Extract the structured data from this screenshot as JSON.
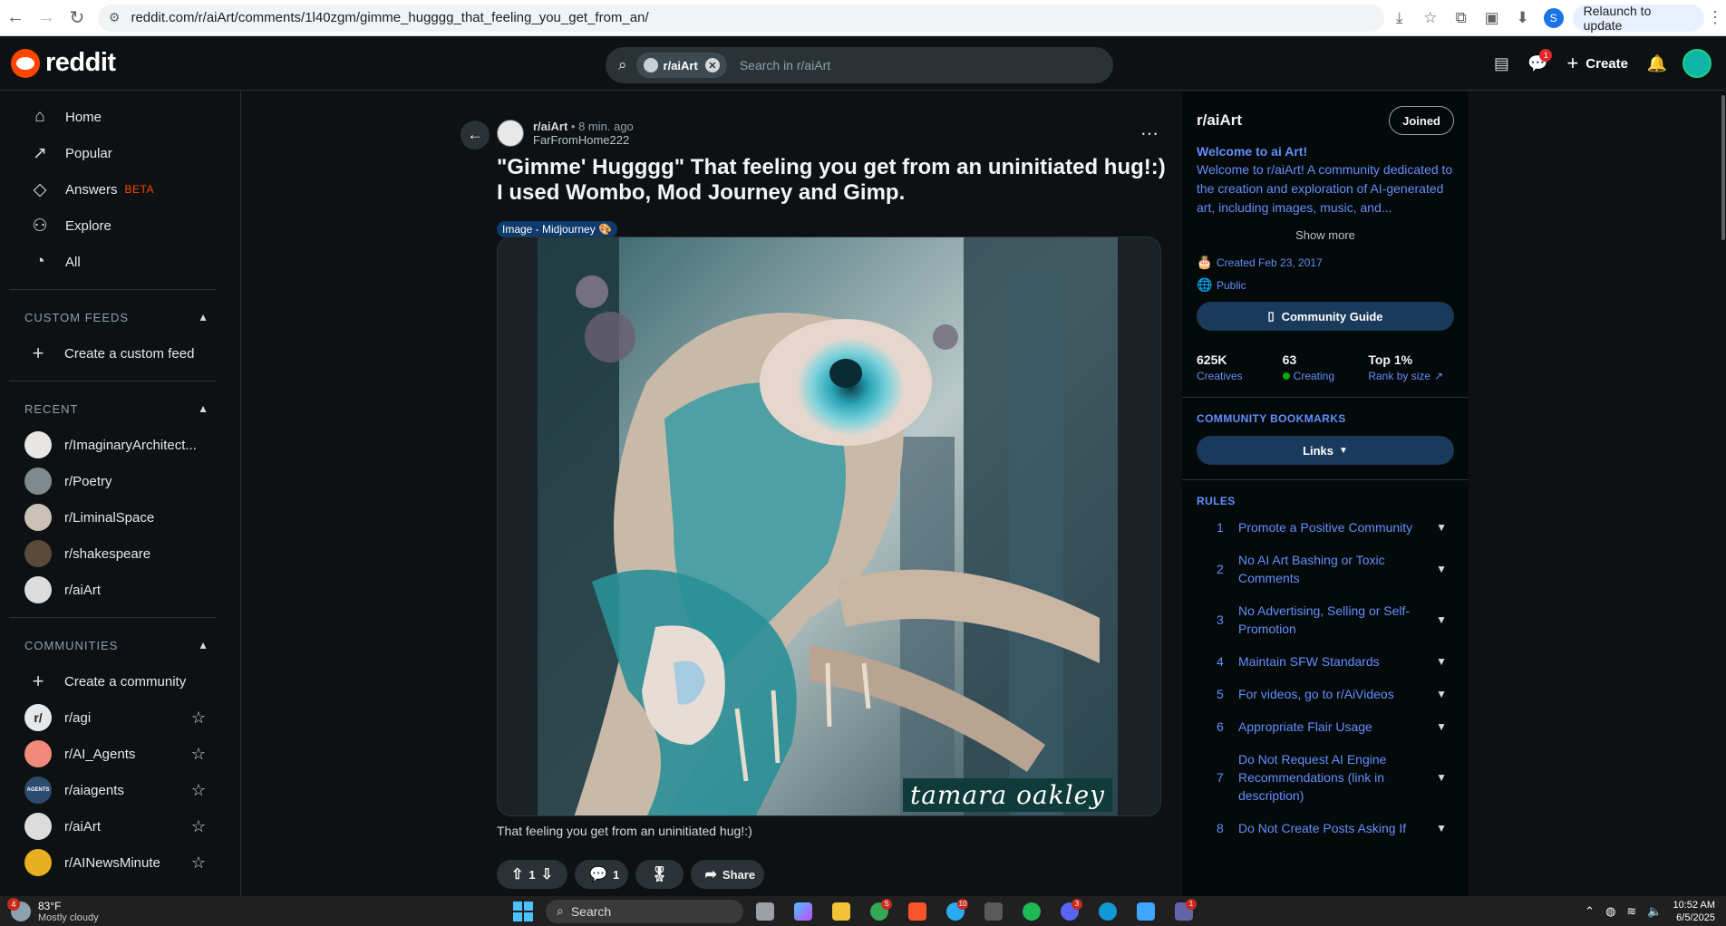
{
  "browser": {
    "url": "reddit.com/r/aiArt/comments/1l40zgm/gimme_hugggg_that_feeling_you_get_from_an/",
    "profile_initial": "S",
    "relaunch_label": "Relaunch to update"
  },
  "header": {
    "logo_text": "reddit",
    "search_chip": "r/aiArt",
    "search_placeholder": "Search in r/aiArt",
    "create_label": "Create",
    "chat_badge": "1"
  },
  "sidebar": {
    "nav": [
      {
        "label": "Home",
        "icon": "home-icon"
      },
      {
        "label": "Popular",
        "icon": "popular-icon"
      },
      {
        "label": "Answers",
        "icon": "answers-icon",
        "badge": "BETA"
      },
      {
        "label": "Explore",
        "icon": "explore-icon"
      },
      {
        "label": "All",
        "icon": "all-icon"
      }
    ],
    "custom_feeds_title": "CUSTOM FEEDS",
    "create_custom_feed": "Create a custom feed",
    "recent_title": "RECENT",
    "recent": [
      {
        "name": "r/ImaginaryArchitect...",
        "color": "#e8e6e2"
      },
      {
        "name": "r/Poetry",
        "color": "#7e8a8c"
      },
      {
        "name": "r/LiminalSpace",
        "color": "#c9c2b4"
      },
      {
        "name": "r/shakespeare",
        "color": "#5a4a3a"
      },
      {
        "name": "r/aiArt",
        "color": "#dcdcdc"
      }
    ],
    "communities_title": "COMMUNITIES",
    "create_community": "Create a community",
    "communities": [
      {
        "name": "r/agi",
        "color": "#e6e8e9",
        "mark": "r/"
      },
      {
        "name": "r/AI_Agents",
        "color": "#f08a7a",
        "mark": ""
      },
      {
        "name": "r/aiagents",
        "color": "#2b4b6f",
        "mark": "AGENTS"
      },
      {
        "name": "r/aiArt",
        "color": "#dcdcdc",
        "mark": ""
      },
      {
        "name": "r/AINewsMinute",
        "color": "#e8b020",
        "mark": ""
      }
    ]
  },
  "post": {
    "subreddit": "r/aiArt",
    "time": "• 8 min. ago",
    "author": "FarFromHome222",
    "title": "\"Gimme' Hugggg\" That feeling you get from an uninitiated hug!:) I used Wombo, Mod Journey and Gimp.",
    "flair": "Image - Midjourney 🎨",
    "watermark": "tamara oakley",
    "caption": "That feeling you get from an uninitiated hug!:)",
    "votes": "1",
    "comments": "1",
    "share_label": "Share"
  },
  "community": {
    "name": "r/aiArt",
    "joined_label": "Joined",
    "welcome_title": "Welcome to ai Art!",
    "welcome_desc": "Welcome to r/aiArt! A community dedicated to the creation and exploration of AI-generated art, including images, music, and...",
    "show_more": "Show more",
    "created": "Created Feb 23, 2017",
    "visibility": "Public",
    "guide_label": "Community Guide",
    "stats": [
      {
        "value": "625K",
        "label": "Creatives"
      },
      {
        "value": "63",
        "label": "Creating"
      },
      {
        "value": "Top 1%",
        "label": "Rank by size"
      }
    ],
    "bookmarks_title": "COMMUNITY BOOKMARKS",
    "links_label": "Links",
    "rules_title": "RULES",
    "rules": [
      {
        "n": "1",
        "text": "Promote a Positive Community"
      },
      {
        "n": "2",
        "text": "No AI Art Bashing or Toxic Comments"
      },
      {
        "n": "3",
        "text": "No Advertising, Selling or Self-Promotion"
      },
      {
        "n": "4",
        "text": "Maintain SFW Standards"
      },
      {
        "n": "5",
        "text": "For videos, go to r/AiVideos"
      },
      {
        "n": "6",
        "text": "Appropriate Flair Usage"
      },
      {
        "n": "7",
        "text": "Do Not Request AI Engine Recommendations (link in description)"
      },
      {
        "n": "8",
        "text": "Do Not Create Posts Asking If"
      }
    ]
  },
  "taskbar": {
    "temp": "83°F",
    "weather": "Mostly cloudy",
    "weather_badge": "4",
    "search_label": "Search",
    "time": "10:52 AM",
    "date": "6/5/2025"
  }
}
